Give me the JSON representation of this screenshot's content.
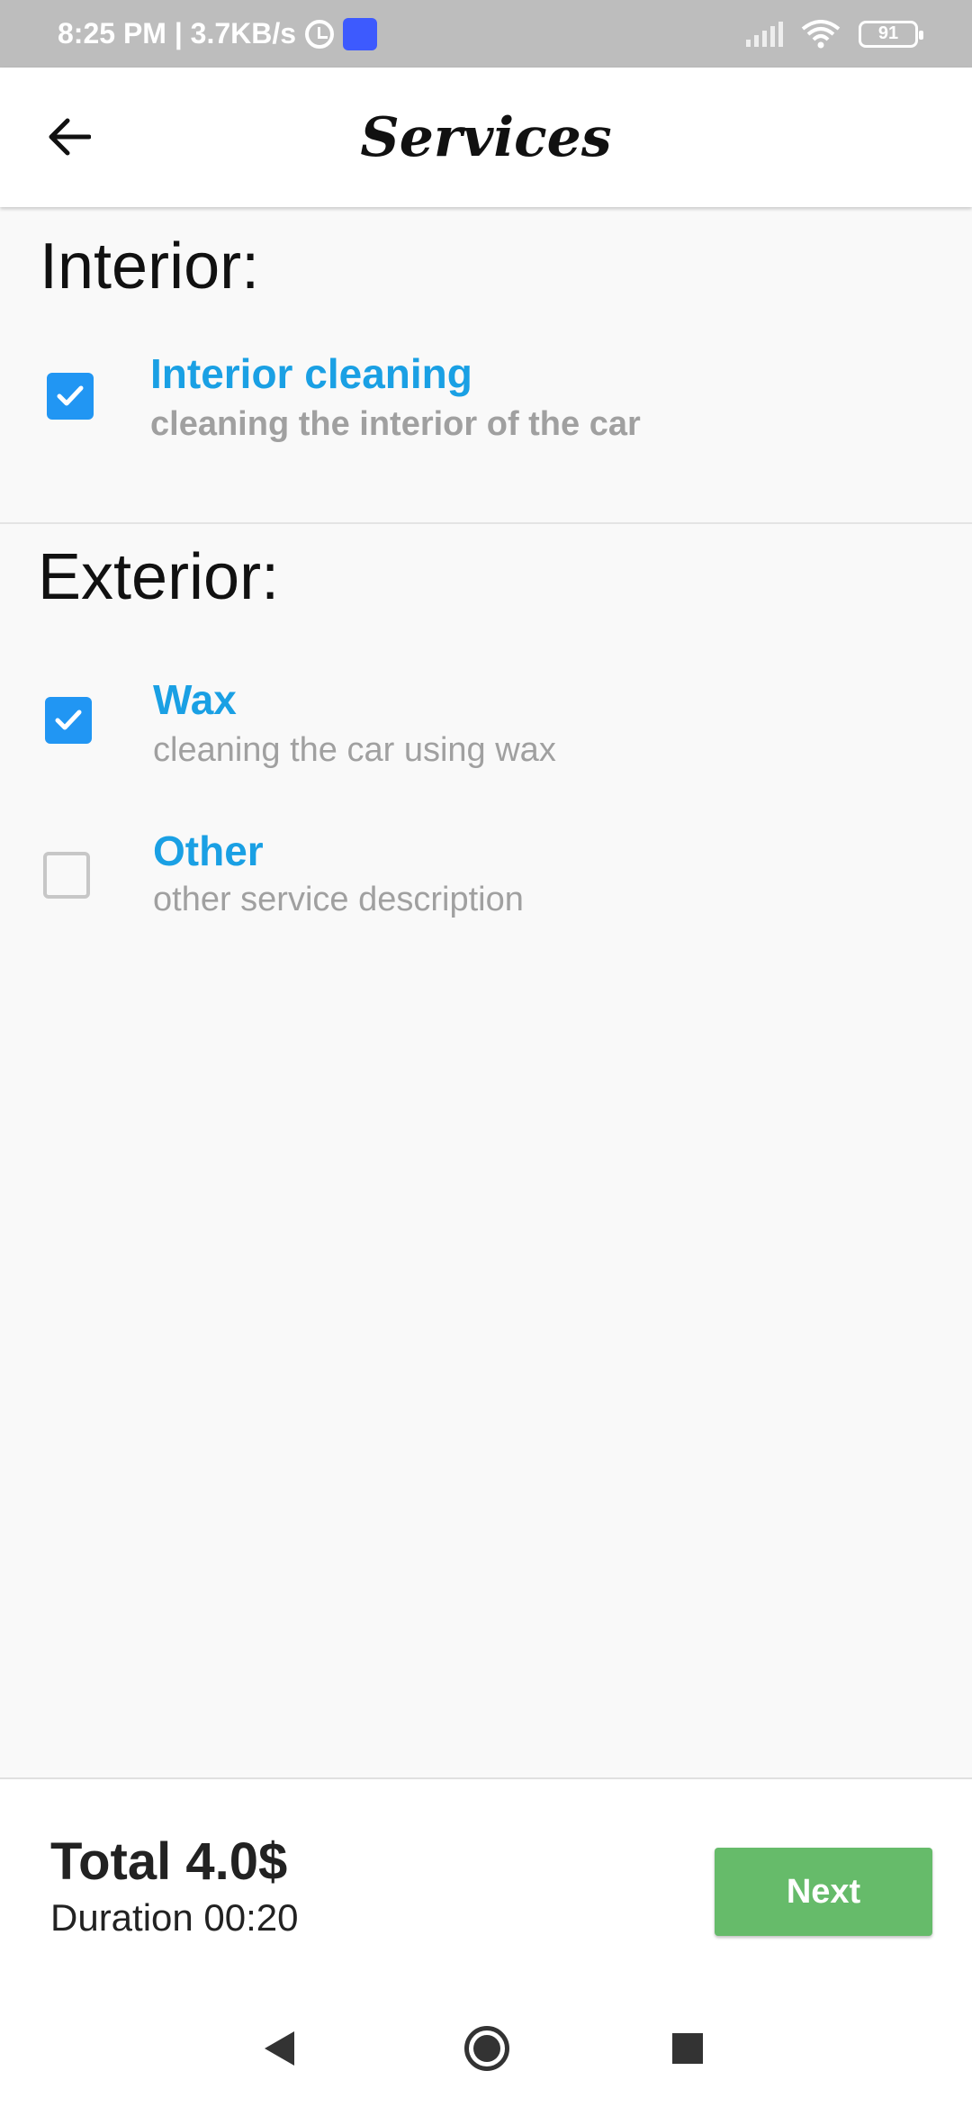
{
  "status_bar": {
    "time_speed": "8:25 PM | 3.7KB/s",
    "battery": "91",
    "icons": [
      "alarm-icon",
      "app-notification-icon",
      "signal-icon",
      "wifi-icon",
      "battery-icon"
    ]
  },
  "app_bar": {
    "title": "Services",
    "back_icon": "arrow-left-icon"
  },
  "sections": {
    "interior": {
      "title": "Interior:",
      "items": [
        {
          "title": "Interior cleaning",
          "description": "cleaning the interior of the car",
          "checked": true
        }
      ]
    },
    "exterior": {
      "title": "Exterior:",
      "items": [
        {
          "title": "Wax",
          "description": "cleaning the car using wax",
          "checked": true
        },
        {
          "title": "Other",
          "description": "other service description",
          "checked": false
        }
      ]
    }
  },
  "summary": {
    "total": "Total 4.0$",
    "duration": "Duration 00:20",
    "next_label": "Next"
  },
  "colors": {
    "accent_blue": "#1aa0e4",
    "checkbox_blue": "#2196f3",
    "next_green": "#66bb6a",
    "status_gray": "#bdbdbd"
  }
}
